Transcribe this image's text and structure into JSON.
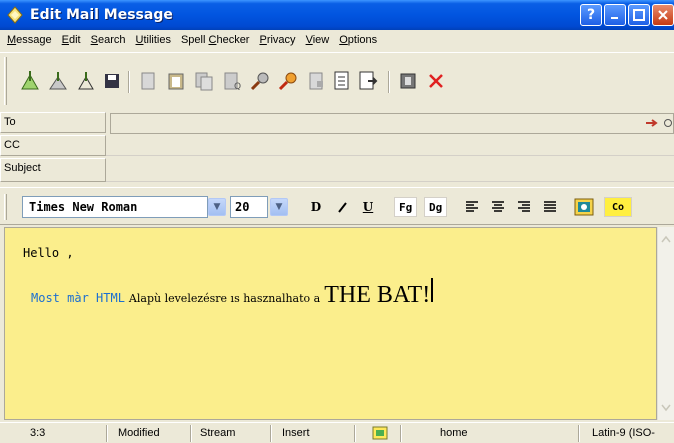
{
  "window": {
    "title": "Edit Mail Message",
    "buttons": {
      "help": "?",
      "minimize": "_",
      "maximize": "□",
      "close": "✕"
    }
  },
  "menu": [
    {
      "label": "Message",
      "accel": "M"
    },
    {
      "label": "Edit",
      "accel": "E"
    },
    {
      "label": "Search",
      "accel": "S"
    },
    {
      "label": "Utilities",
      "accel": "U"
    },
    {
      "label": "Spell Checker",
      "accel": "C"
    },
    {
      "label": "Privacy",
      "accel": "P"
    },
    {
      "label": "View",
      "accel": "V"
    },
    {
      "label": "Options",
      "accel": "O"
    }
  ],
  "header": {
    "to_label": "To",
    "cc_label": "CC",
    "subject_label": "Subject",
    "to_value": "",
    "cc_value": "",
    "subject_value": ""
  },
  "format": {
    "font": "Times New Roman",
    "size": "20",
    "bold": "D",
    "italic": "/",
    "underline": "U",
    "fg": "Fg",
    "bg": "Dg",
    "color": "Co"
  },
  "editor": {
    "line1": "Hello ,",
    "line2_mono": "Most màr HTML",
    "line2_small": "Alapù levelezésre ıs hasznalhato a",
    "line2_big": "THE BAT!",
    "background": "#fbee8c",
    "link_color": "#1c6fd0"
  },
  "status": {
    "position": "3:3",
    "modified": "Modified",
    "mode": "Stream",
    "insert": "Insert",
    "account": "home",
    "charset": "Latin-9 (ISO-"
  }
}
